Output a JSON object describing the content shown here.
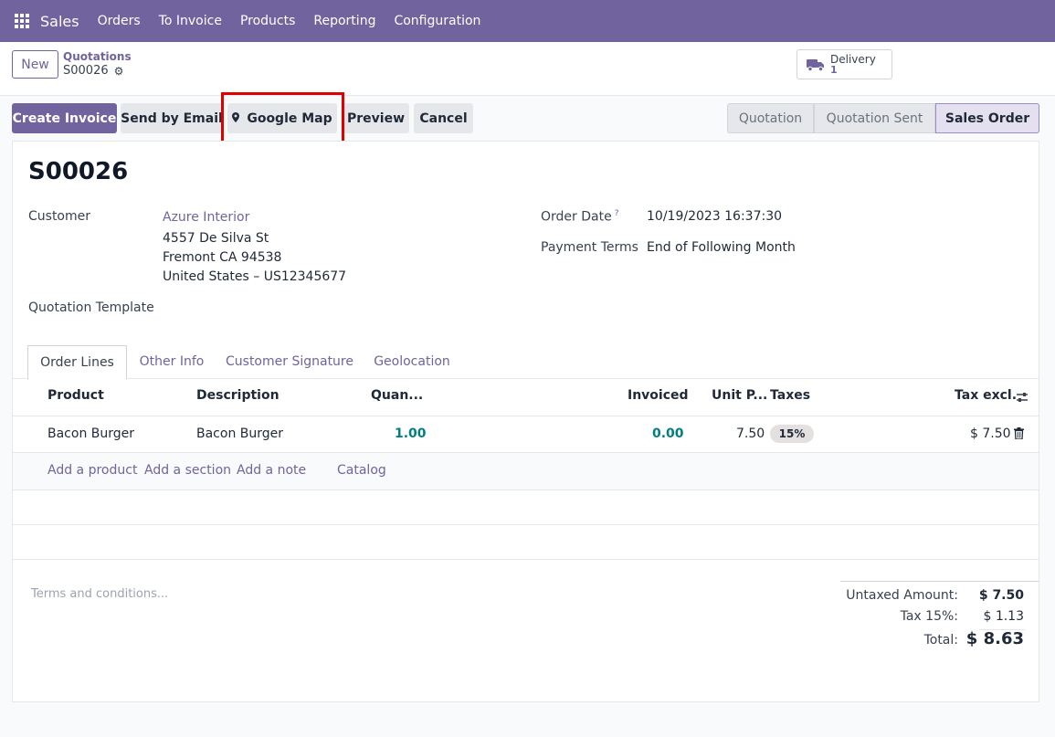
{
  "navbar": {
    "brand": "Sales",
    "menu": [
      "Orders",
      "To Invoice",
      "Products",
      "Reporting",
      "Configuration"
    ]
  },
  "control": {
    "new_label": "New",
    "breadcrumb_parent": "Quotations",
    "breadcrumb_current": "S00026",
    "delivery_label": "Delivery",
    "delivery_count": "1"
  },
  "actions": {
    "create_invoice": "Create Invoice",
    "send_by_email": "Send by Email",
    "google_map": "Google Map",
    "preview": "Preview",
    "cancel": "Cancel"
  },
  "status_stages": [
    "Quotation",
    "Quotation Sent",
    "Sales Order"
  ],
  "status_active": "Sales Order",
  "form": {
    "title": "S00026",
    "customer_label": "Customer",
    "customer_name": "Azure Interior",
    "address_line1": "4557 De Silva St",
    "address_line2": "Fremont CA 94538",
    "address_line3": "United States – US12345677",
    "template_label": "Quotation Template",
    "order_date_label": "Order Date",
    "order_date_help": "?",
    "order_date": "10/19/2023 16:37:30",
    "payment_terms_label": "Payment Terms",
    "payment_terms": "End of Following Month"
  },
  "tabs": [
    "Order Lines",
    "Other Info",
    "Customer Signature",
    "Geolocation"
  ],
  "table": {
    "headers": {
      "product": "Product",
      "description": "Description",
      "quantity": "Quan...",
      "invoiced": "Invoiced",
      "unit_price": "Unit P...",
      "taxes": "Taxes",
      "tax_excl": "Tax excl."
    },
    "rows": [
      {
        "product": "Bacon Burger",
        "description": "Bacon Burger",
        "quantity": "1.00",
        "invoiced": "0.00",
        "unit_price": "7.50",
        "tax": "15%",
        "subtotal": "$ 7.50"
      }
    ],
    "add_product": "Add a product",
    "add_section": "Add a section",
    "add_note": "Add a note",
    "catalog": "Catalog"
  },
  "terms_placeholder": "Terms and conditions...",
  "totals": {
    "untaxed_label": "Untaxed Amount:",
    "untaxed_value": "$ 7.50",
    "tax_label": "Tax 15%:",
    "tax_value": "$ 1.13",
    "total_label": "Total:",
    "total_value": "$ 8.63"
  },
  "colors": {
    "brand": "#71639e",
    "highlight": "#e10000",
    "numeric": "#017e84"
  }
}
